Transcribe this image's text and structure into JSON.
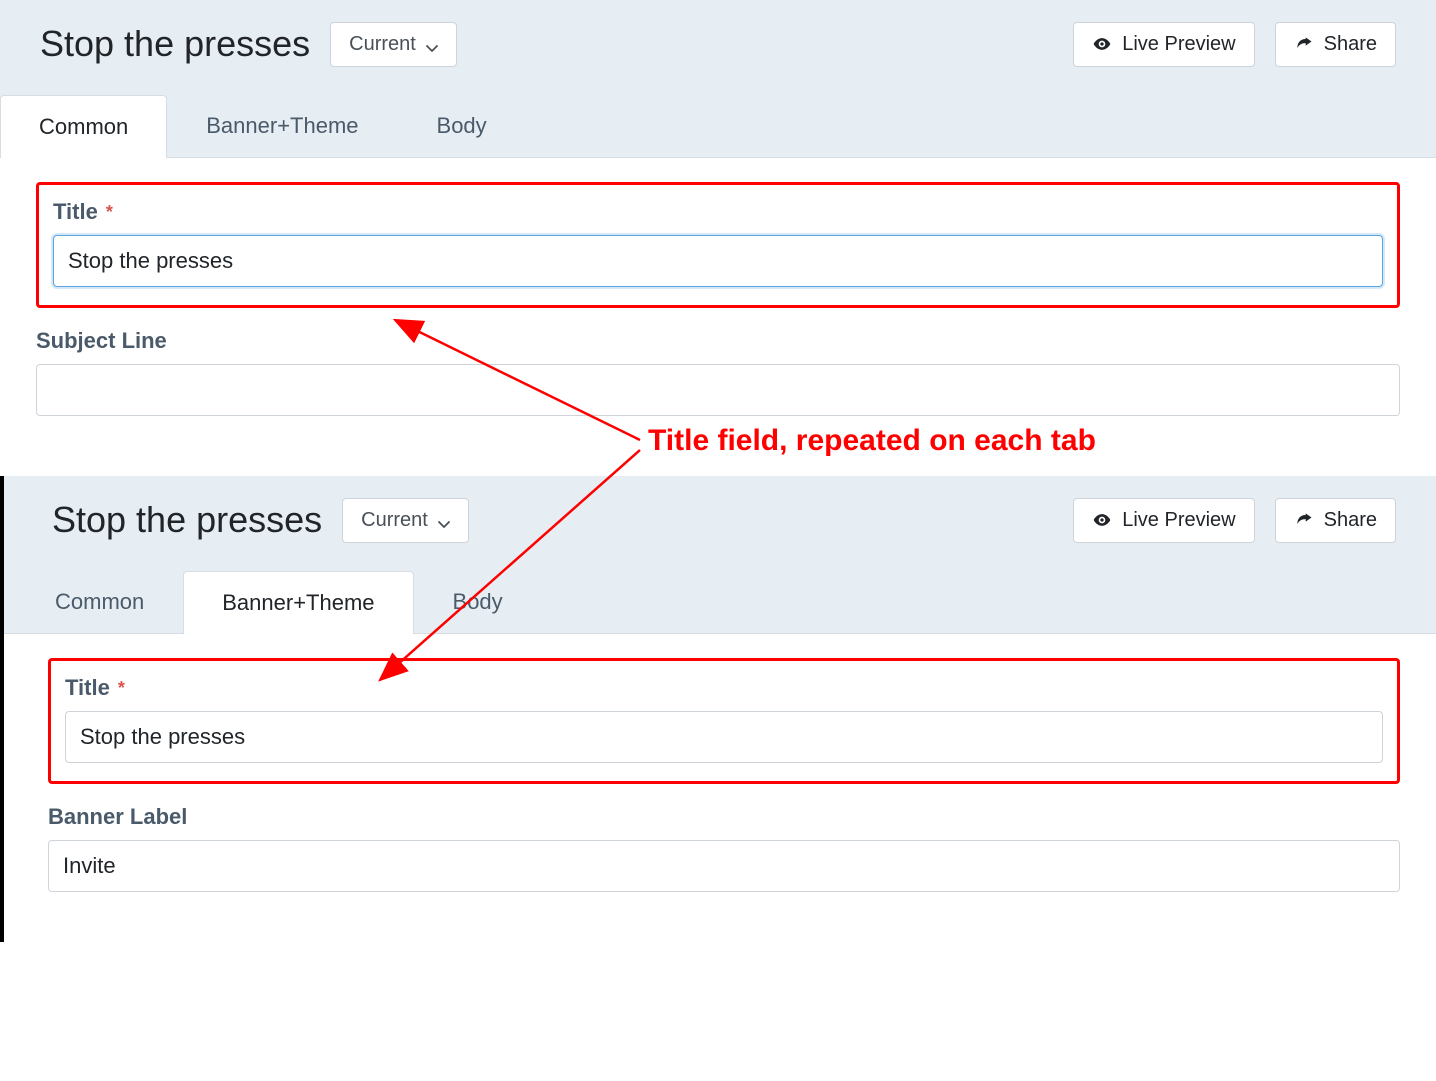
{
  "annotation": {
    "text": "Title field, repeated on each tab"
  },
  "panel1": {
    "title": "Stop the presses",
    "version_label": "Current",
    "live_preview_label": "Live Preview",
    "share_label": "Share",
    "tabs": {
      "common": "Common",
      "banner": "Banner+Theme",
      "body": "Body"
    },
    "active_tab": "common",
    "fields": {
      "title_label": "Title",
      "title_value": "Stop the presses",
      "subject_label": "Subject Line",
      "subject_value": ""
    }
  },
  "panel2": {
    "title": "Stop the presses",
    "version_label": "Current",
    "live_preview_label": "Live Preview",
    "share_label": "Share",
    "tabs": {
      "common": "Common",
      "banner": "Banner+Theme",
      "body": "Body"
    },
    "active_tab": "banner",
    "fields": {
      "title_label": "Title",
      "title_value": "Stop the presses",
      "banner_label_label": "Banner Label",
      "banner_label_value": "Invite"
    }
  }
}
